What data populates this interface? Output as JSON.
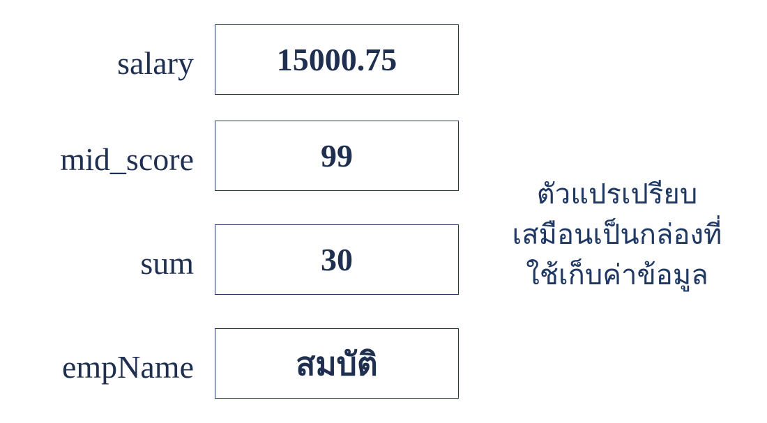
{
  "variables": [
    {
      "name": "salary",
      "value": "15000.75"
    },
    {
      "name": "mid_score",
      "value": "99"
    },
    {
      "name": "sum",
      "value": "30"
    },
    {
      "name": "empName",
      "value": "สมบัติ"
    }
  ],
  "caption": {
    "line1": "ตัวแปรเปรียบ",
    "line2": "เสมือนเป็นกล่องที่",
    "line3": "ใช้เก็บค่าข้อมูล"
  },
  "colors": {
    "text": "#1f2f4f",
    "box_border": "#1f3864",
    "caption": "#1f3864"
  }
}
